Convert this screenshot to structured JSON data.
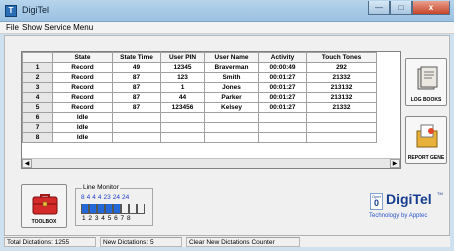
{
  "window": {
    "title": "DigiTel",
    "app_icon": "T",
    "min": "—",
    "max": "□",
    "close": "x"
  },
  "menu": {
    "items": [
      "File",
      "Show Service Menu"
    ]
  },
  "grid": {
    "columns": [
      "",
      "State",
      "State Time",
      "User PIN",
      "User Name",
      "Activity",
      "Touch Tones"
    ],
    "rows": [
      [
        "1",
        "Record",
        "49",
        "12345",
        "Braverman",
        "00:00:49",
        "292"
      ],
      [
        "2",
        "Record",
        "87",
        "123",
        "Smith",
        "00:01:27",
        "21332"
      ],
      [
        "3",
        "Record",
        "87",
        "1",
        "Jones",
        "00:01:27",
        "213132"
      ],
      [
        "4",
        "Record",
        "87",
        "44",
        "Parker",
        "00:01:27",
        "213132"
      ],
      [
        "5",
        "Record",
        "87",
        "123456",
        "Kelsey",
        "00:01:27",
        "21332"
      ],
      [
        "6",
        "Idle",
        "",
        "",
        "",
        "",
        ""
      ],
      [
        "7",
        "Idle",
        "",
        "",
        "",
        "",
        ""
      ],
      [
        "8",
        "Idle",
        "",
        "",
        "",
        "",
        ""
      ]
    ]
  },
  "side_buttons": {
    "log_books": "LOG BOOKS",
    "report_gene": "REPORT GENE"
  },
  "toolbox": {
    "label": "TOOLBOX"
  },
  "line_monitor": {
    "title": "Line Monitor",
    "counts": [
      "8",
      "4",
      "4",
      "4",
      "23",
      "24",
      "24"
    ],
    "line_numbers": [
      "1",
      "2",
      "3",
      "4",
      "5",
      "6",
      "7",
      "8"
    ],
    "active_lines": [
      1,
      2,
      3,
      4,
      5
    ]
  },
  "logo": {
    "oper": "Oper",
    "zero": "0",
    "name": "DigiTel",
    "tm": "TM",
    "subtitle": "Technology by Apptec"
  },
  "status": {
    "total_dictations": "Total Dictations:  1255",
    "new_dictations": "New Dictations:  5",
    "clear_button": "Clear New Dictations Counter"
  },
  "colors": {
    "accent": "#173d8e",
    "line_on": "#2468d8",
    "titlebar": "#a6c9e6"
  }
}
